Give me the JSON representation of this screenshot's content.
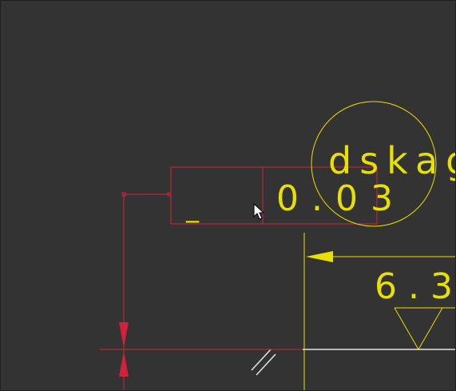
{
  "viewport": {
    "background": "#333333"
  },
  "annotation_circle": {
    "label": "dskag",
    "color": "#e8e000"
  },
  "feature_control_frame": {
    "symbol": "_",
    "tolerance": "0.03",
    "frame_color": "#d4203c",
    "text_color": "#e8e000"
  },
  "surface_finish": {
    "value": "6.3",
    "color": "#e8e000"
  },
  "colors": {
    "selected": "#d4203c",
    "annotation": "#e8e000",
    "geometry": "#ffffff"
  },
  "cursor": {
    "icon": "arrow-pointer-icon"
  }
}
